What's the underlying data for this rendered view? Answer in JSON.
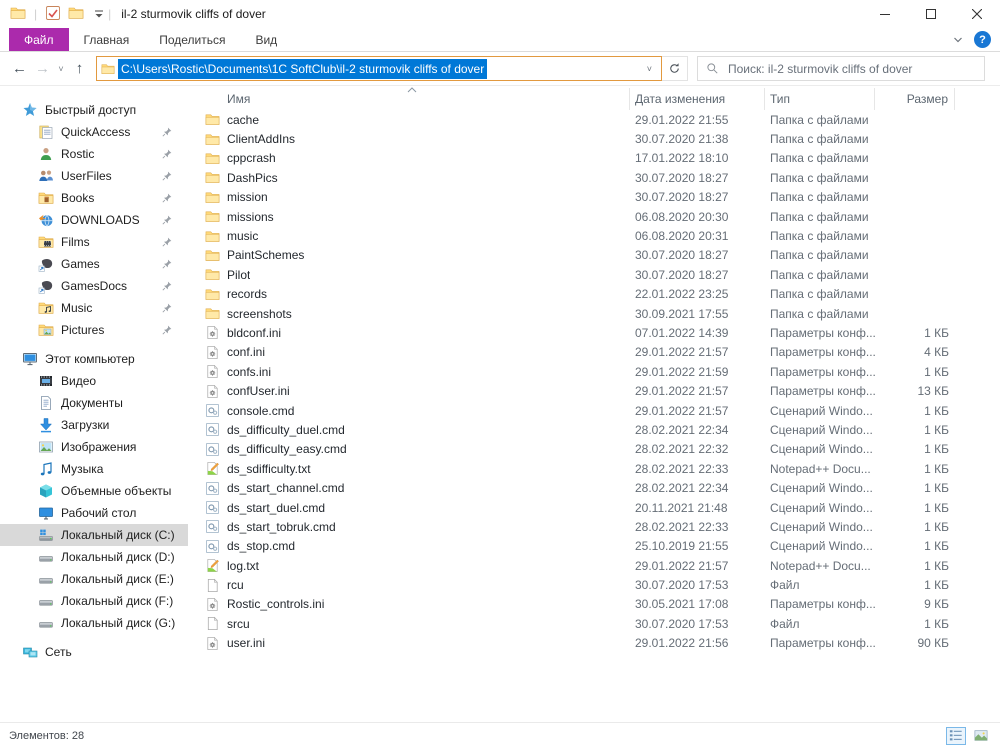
{
  "colors": {
    "file_tab_magenta": "#ab2aac",
    "selection_blue": "#0078d7",
    "address_focus_border": "#e2993f",
    "sidebar_selected_bg": "#d9d9d9",
    "help_blue": "#1977d4"
  },
  "window": {
    "title": "il-2 sturmovik cliffs of dover",
    "controls": [
      "minimize-icon",
      "maximize-icon",
      "close-icon"
    ]
  },
  "qat": {
    "icons": [
      "folder-icon",
      "checkbox-icon",
      "folder-icon",
      "qat-dropdown-icon"
    ]
  },
  "ribbon": {
    "tabs": [
      {
        "label": "Файл",
        "active": true
      },
      {
        "label": "Главная",
        "active": false
      },
      {
        "label": "Поделиться",
        "active": false
      },
      {
        "label": "Вид",
        "active": false
      }
    ],
    "help_label": "?"
  },
  "toolbar": {
    "address": {
      "icon": "folder-icon",
      "path": "C:\\Users\\Rostic\\Documents\\1C SoftClub\\il-2 sturmovik cliffs of dover"
    },
    "search": {
      "placeholder": "Поиск: il-2 sturmovik cliffs of dover"
    }
  },
  "sidebar": {
    "sections": [
      {
        "header": {
          "icon": "quick-access-star-icon",
          "label": "Быстрый доступ"
        },
        "items": [
          {
            "icon": "notes-icon",
            "label": "QuickAccess",
            "pinned": true
          },
          {
            "icon": "user-icon",
            "label": "Rostic",
            "pinned": true
          },
          {
            "icon": "users-icon",
            "label": "UserFiles",
            "pinned": true
          },
          {
            "icon": "folder-books-icon",
            "label": "Books",
            "pinned": true
          },
          {
            "icon": "globe-download-icon",
            "label": "DOWNLOADS",
            "pinned": true
          },
          {
            "icon": "folder-films-icon",
            "label": "Films",
            "pinned": true
          },
          {
            "icon": "app-shortcut-icon",
            "label": "Games",
            "pinned": true
          },
          {
            "icon": "app-shortcut-icon",
            "label": "GamesDocs",
            "pinned": true
          },
          {
            "icon": "folder-music-icon",
            "label": "Music",
            "pinned": true
          },
          {
            "icon": "folder-pictures-icon",
            "label": "Pictures",
            "pinned": true
          }
        ]
      },
      {
        "header": {
          "icon": "computer-icon",
          "label": "Этот компьютер"
        },
        "items": [
          {
            "icon": "videos-icon",
            "label": "Видео"
          },
          {
            "icon": "documents-icon",
            "label": "Документы"
          },
          {
            "icon": "downloads-icon",
            "label": "Загрузки"
          },
          {
            "icon": "images-icon",
            "label": "Изображения"
          },
          {
            "icon": "music-note-icon",
            "label": "Музыка"
          },
          {
            "icon": "cube-3d-icon",
            "label": "Объемные объекты"
          },
          {
            "icon": "desktop-icon",
            "label": "Рабочий стол"
          },
          {
            "icon": "disk-windows-icon",
            "label": "Локальный диск (C:)",
            "selected": true
          },
          {
            "icon": "disk-icon",
            "label": "Локальный диск (D:)"
          },
          {
            "icon": "disk-icon",
            "label": "Локальный диск (E:)"
          },
          {
            "icon": "disk-icon",
            "label": "Локальный диск (F:)"
          },
          {
            "icon": "disk-icon",
            "label": "Локальный диск (G:)"
          }
        ]
      },
      {
        "header": {
          "icon": "network-icon",
          "label": "Сеть"
        },
        "items": []
      }
    ]
  },
  "list": {
    "columns": [
      {
        "label": "Имя",
        "sort": "asc"
      },
      {
        "label": "Дата изменения"
      },
      {
        "label": "Тип"
      },
      {
        "label": "Размер"
      }
    ],
    "rows": [
      {
        "icon": "folder-icon",
        "name": "cache",
        "date": "29.01.2022 21:55",
        "type": "Папка с файлами",
        "size": ""
      },
      {
        "icon": "folder-icon",
        "name": "ClientAddIns",
        "date": "30.07.2020 21:38",
        "type": "Папка с файлами",
        "size": ""
      },
      {
        "icon": "folder-icon",
        "name": "cppcrash",
        "date": "17.01.2022 18:10",
        "type": "Папка с файлами",
        "size": ""
      },
      {
        "icon": "folder-icon",
        "name": "DashPics",
        "date": "30.07.2020 18:27",
        "type": "Папка с файлами",
        "size": ""
      },
      {
        "icon": "folder-icon",
        "name": "mission",
        "date": "30.07.2020 18:27",
        "type": "Папка с файлами",
        "size": ""
      },
      {
        "icon": "folder-icon",
        "name": "missions",
        "date": "06.08.2020 20:30",
        "type": "Папка с файлами",
        "size": ""
      },
      {
        "icon": "folder-icon",
        "name": "music",
        "date": "06.08.2020 20:31",
        "type": "Папка с файлами",
        "size": ""
      },
      {
        "icon": "folder-icon",
        "name": "PaintSchemes",
        "date": "30.07.2020 18:27",
        "type": "Папка с файлами",
        "size": ""
      },
      {
        "icon": "folder-icon",
        "name": "Pilot",
        "date": "30.07.2020 18:27",
        "type": "Папка с файлами",
        "size": ""
      },
      {
        "icon": "folder-icon",
        "name": "records",
        "date": "22.01.2022 23:25",
        "type": "Папка с файлами",
        "size": ""
      },
      {
        "icon": "folder-icon",
        "name": "screenshots",
        "date": "30.09.2021 17:55",
        "type": "Папка с файлами",
        "size": ""
      },
      {
        "icon": "ini-file-icon",
        "name": "bldconf.ini",
        "date": "07.01.2022 14:39",
        "type": "Параметры конф...",
        "size": "1 КБ"
      },
      {
        "icon": "ini-file-icon",
        "name": "conf.ini",
        "date": "29.01.2022 21:57",
        "type": "Параметры конф...",
        "size": "4 КБ"
      },
      {
        "icon": "ini-file-icon",
        "name": "confs.ini",
        "date": "29.01.2022 21:59",
        "type": "Параметры конф...",
        "size": "1 КБ"
      },
      {
        "icon": "ini-file-icon",
        "name": "confUser.ini",
        "date": "29.01.2022 21:57",
        "type": "Параметры конф...",
        "size": "13 КБ"
      },
      {
        "icon": "cmd-file-icon",
        "name": "console.cmd",
        "date": "29.01.2022 21:57",
        "type": "Сценарий Windo...",
        "size": "1 КБ"
      },
      {
        "icon": "cmd-file-icon",
        "name": "ds_difficulty_duel.cmd",
        "date": "28.02.2021 22:34",
        "type": "Сценарий Windo...",
        "size": "1 КБ"
      },
      {
        "icon": "cmd-file-icon",
        "name": "ds_difficulty_easy.cmd",
        "date": "28.02.2021 22:32",
        "type": "Сценарий Windo...",
        "size": "1 КБ"
      },
      {
        "icon": "npp-file-icon",
        "name": "ds_sdifficulty.txt",
        "date": "28.02.2021 22:33",
        "type": "Notepad++ Docu...",
        "size": "1 КБ"
      },
      {
        "icon": "cmd-file-icon",
        "name": "ds_start_channel.cmd",
        "date": "28.02.2021 22:34",
        "type": "Сценарий Windo...",
        "size": "1 КБ"
      },
      {
        "icon": "cmd-file-icon",
        "name": "ds_start_duel.cmd",
        "date": "20.11.2021 21:48",
        "type": "Сценарий Windo...",
        "size": "1 КБ"
      },
      {
        "icon": "cmd-file-icon",
        "name": "ds_start_tobruk.cmd",
        "date": "28.02.2021 22:33",
        "type": "Сценарий Windo...",
        "size": "1 КБ"
      },
      {
        "icon": "cmd-file-icon",
        "name": "ds_stop.cmd",
        "date": "25.10.2019 21:55",
        "type": "Сценарий Windo...",
        "size": "1 КБ"
      },
      {
        "icon": "npp-file-icon",
        "name": "log.txt",
        "date": "29.01.2022 21:57",
        "type": "Notepad++ Docu...",
        "size": "1 КБ"
      },
      {
        "icon": "blank-file-icon",
        "name": "rcu",
        "date": "30.07.2020 17:53",
        "type": "Файл",
        "size": "1 КБ"
      },
      {
        "icon": "ini-file-icon",
        "name": "Rostic_controls.ini",
        "date": "30.05.2021 17:08",
        "type": "Параметры конф...",
        "size": "9 КБ"
      },
      {
        "icon": "blank-file-icon",
        "name": "srcu",
        "date": "30.07.2020 17:53",
        "type": "Файл",
        "size": "1 КБ"
      },
      {
        "icon": "ini-file-icon",
        "name": "user.ini",
        "date": "29.01.2022 21:56",
        "type": "Параметры конф...",
        "size": "90 КБ"
      }
    ]
  },
  "status": {
    "items_label": "Элементов: 28",
    "views": [
      {
        "icon": "details-view-icon",
        "selected": true
      },
      {
        "icon": "thumbnails-view-icon",
        "selected": false
      }
    ]
  }
}
